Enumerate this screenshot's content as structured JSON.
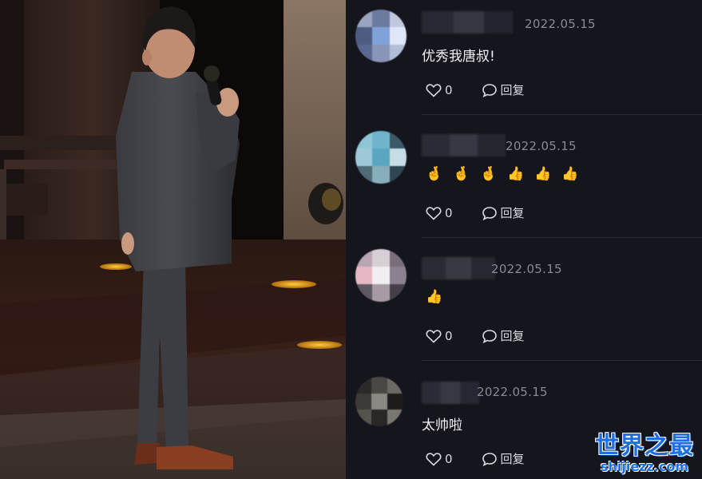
{
  "comments": [
    {
      "date": "2022.05.15",
      "text": "优秀我唐叔!",
      "emojis": [],
      "likes": "0",
      "reply_label": "回复",
      "avatar_colors": [
        "#9aa4c0",
        "#6c7aa0",
        "#c0c8e0",
        "#4f5c82",
        "#7fa2d8",
        "#dfe6f5",
        "#5a6890",
        "#8895b8",
        "#b4bdd6"
      ]
    },
    {
      "date": "2022.05.15",
      "text": "",
      "emojis": [
        "🤞",
        "🤞",
        "🤞",
        "👍",
        "👍",
        "👍"
      ],
      "likes": "0",
      "reply_label": "回复",
      "avatar_colors": [
        "#8fc6d6",
        "#6fb4cc",
        "#3a5a6a",
        "#9cc8d8",
        "#5aa6c2",
        "#c7dde6",
        "#4f6b78",
        "#88aebb",
        "#2f4550"
      ]
    },
    {
      "date": "2022.05.15",
      "text": "",
      "emojis": [
        "👍"
      ],
      "likes": "0",
      "reply_label": "回复",
      "avatar_colors": [
        "#b9a6b2",
        "#d7cfd6",
        "#7a6e79",
        "#e8b7c4",
        "#f0eef0",
        "#8b8290",
        "#5e5862",
        "#a79aa5",
        "#463f48"
      ]
    },
    {
      "date": "2022.05.15",
      "text": "太帅啦",
      "emojis": [],
      "likes": "0",
      "reply_label": "回复",
      "avatar_colors": [
        "#2c2a28",
        "#4a4744",
        "#6d6a66",
        "#3d3a37",
        "#8c8884",
        "#1e1c1b",
        "#575450",
        "#2a2826",
        "#7a7672"
      ]
    }
  ],
  "watermark": {
    "title": "世界之最",
    "url": "shijiezz.com"
  },
  "colors": {
    "panel_bg": "#15151d",
    "text": "#f1f1f4",
    "date": "#8a8a94",
    "watermark": "#1e6fe0"
  },
  "icons": {
    "like": "heart-outline-icon",
    "reply": "speech-bubble-icon"
  }
}
